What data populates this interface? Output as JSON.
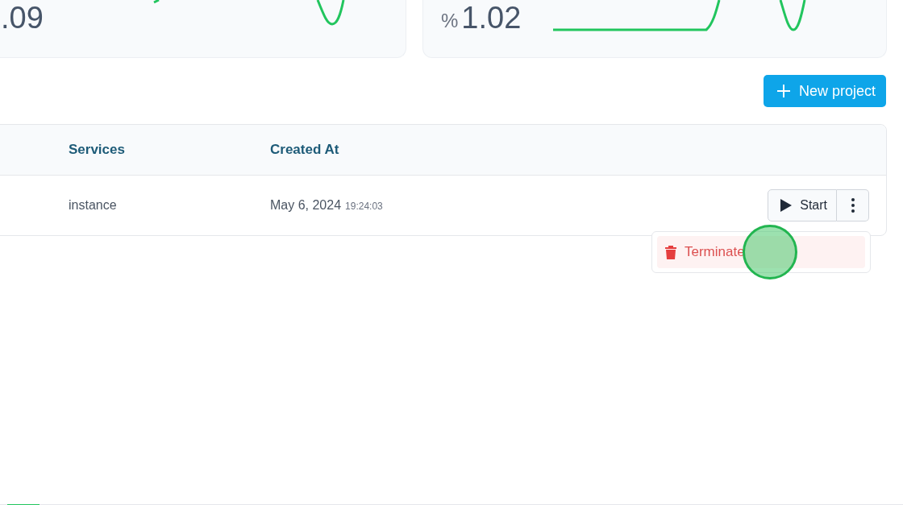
{
  "stat_cards": [
    {
      "value": ".09"
    },
    {
      "unit": "%",
      "value": "1.02"
    }
  ],
  "new_project_button": {
    "label": "New project"
  },
  "table": {
    "columns": [
      "Services",
      "Created At"
    ],
    "rows": [
      {
        "services": "instance",
        "created_date": "May 6, 2024",
        "created_time": "19:24:03",
        "start_label": "Start"
      }
    ]
  },
  "row_menu": {
    "items": [
      {
        "label": "Terminate",
        "kind": "danger"
      }
    ]
  }
}
